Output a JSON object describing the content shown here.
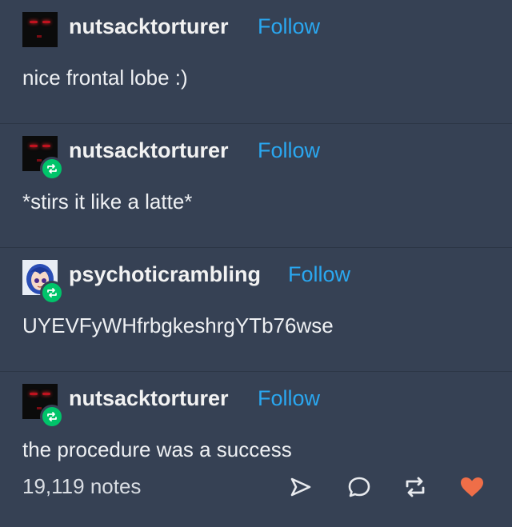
{
  "posts": [
    {
      "username": "nutsacktorturer",
      "follow_label": "Follow",
      "text": "nice frontal lobe :)"
    },
    {
      "username": "nutsacktorturer",
      "follow_label": "Follow",
      "text": "*stirs it like a latte*"
    },
    {
      "username": "psychoticrambling",
      "follow_label": "Follow",
      "text": "UYEVFyWHfrbgkeshrgYTb76wse"
    },
    {
      "username": "nutsacktorturer",
      "follow_label": "Follow",
      "text": "the procedure was a success"
    }
  ],
  "footer": {
    "notes": "19,119 notes",
    "actions": [
      "share-icon",
      "reply-icon",
      "reblog-icon",
      "like-icon"
    ]
  },
  "colors": {
    "background": "#364154",
    "follow": "#2aa7f0",
    "reblog_badge": "#00c46a",
    "like": "#ef6e48"
  }
}
